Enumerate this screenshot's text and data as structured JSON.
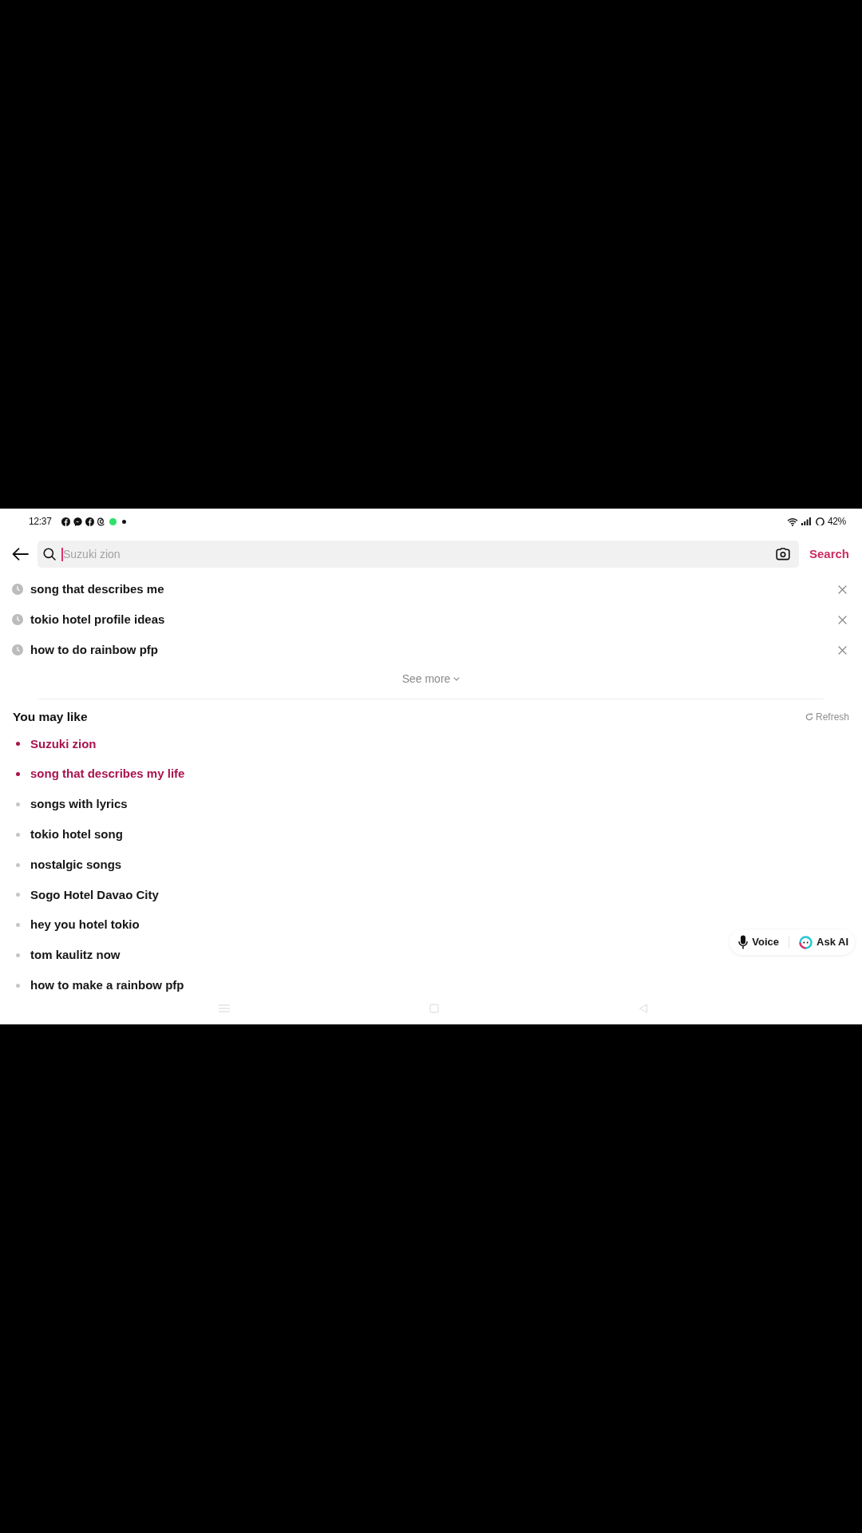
{
  "status_bar": {
    "time": "12:37",
    "battery": "42%"
  },
  "search_bar": {
    "placeholder": "Suzuki zion",
    "action": "Search"
  },
  "history": {
    "items": [
      {
        "text": "song that describes me"
      },
      {
        "text": "tokio hotel profile ideas"
      },
      {
        "text": "how to do rainbow pfp"
      }
    ],
    "see_more": "See more"
  },
  "suggestions": {
    "title": "You may like",
    "refresh": "Refresh",
    "items": [
      {
        "text": "Suzuki zion",
        "highlighted": true
      },
      {
        "text": "song that describes my life",
        "highlighted": true
      },
      {
        "text": "songs with lyrics",
        "highlighted": false
      },
      {
        "text": "tokio hotel song",
        "highlighted": false
      },
      {
        "text": "nostalgic songs",
        "highlighted": false
      },
      {
        "text": "Sogo Hotel Davao City",
        "highlighted": false
      },
      {
        "text": "hey you hotel tokio",
        "highlighted": false
      },
      {
        "text": "tom kaulitz now",
        "highlighted": false
      },
      {
        "text": "how to make a rainbow pfp",
        "highlighted": false
      }
    ]
  },
  "assist": {
    "voice": "Voice",
    "ask_ai": "Ask AI"
  }
}
